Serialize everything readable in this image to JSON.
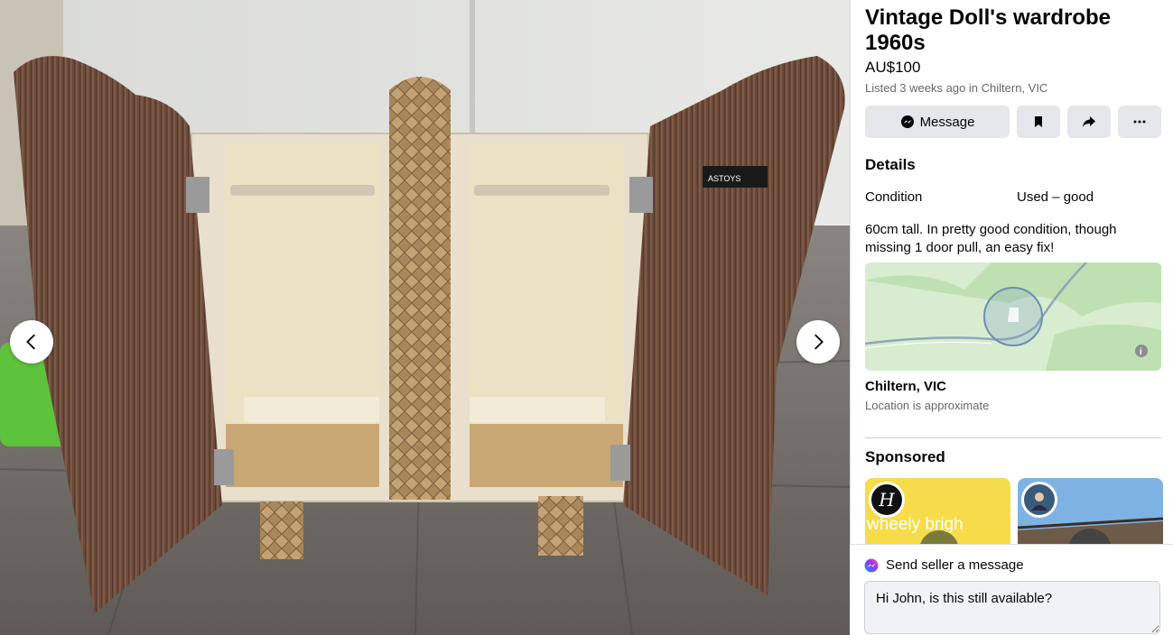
{
  "listing": {
    "title": "Vintage Doll's wardrobe 1960s",
    "price": "AU$100",
    "listed": "Listed 3 weeks ago in Chiltern, VIC",
    "actions": {
      "message_label": "Message",
      "save_icon": "bookmark-icon",
      "share_icon": "share-icon",
      "more_icon": "more-icon"
    },
    "details_heading": "Details",
    "condition_label": "Condition",
    "condition_value": "Used – good",
    "description": "60cm tall. In pretty good condition, though missing 1 door pull, an easy fix!",
    "location_name": "Chiltern, VIC",
    "location_note": "Location is approximate"
  },
  "photo": {
    "sticker_text": "ASTOYS",
    "prev_icon": "chevron-left-icon",
    "next_icon": "chevron-right-icon"
  },
  "sponsored": {
    "heading": "Sponsored",
    "ads": [
      {
        "avatar_letter": "H",
        "text": "wheely brigh"
      },
      {
        "avatar_letter": ""
      }
    ]
  },
  "message_box": {
    "heading": "Send seller a message",
    "value": "Hi John, is this still available?"
  },
  "colors": {
    "button_bg": "#e4e6eb",
    "muted_text": "#65676b",
    "map_green": "#d8ecd0",
    "messenger_gradient": [
      "#0099ff",
      "#a033ff",
      "#ff5280"
    ]
  }
}
